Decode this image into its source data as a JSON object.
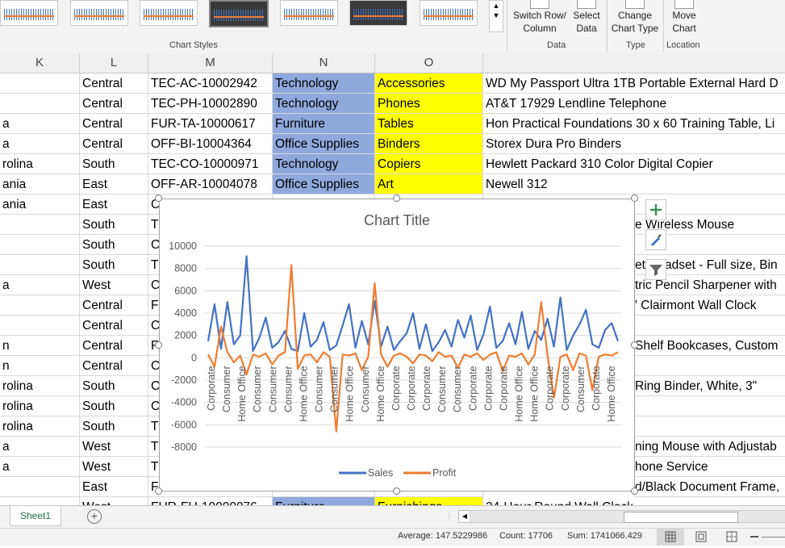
{
  "ribbon": {
    "chart_styles_label": "Chart Styles",
    "switch_row_column": [
      "Switch Row/",
      "Column"
    ],
    "select_data": [
      "Select",
      "Data"
    ],
    "change_chart_type": [
      "Change",
      "Chart Type"
    ],
    "move_chart": [
      "Move",
      "Chart"
    ],
    "group_data": "Data",
    "group_type": "Type",
    "group_location": "Location"
  },
  "columns": [
    "K",
    "L",
    "M",
    "N",
    "O"
  ],
  "rows": [
    [
      "",
      "Central",
      "TEC-AC-10002942",
      "Technology",
      "Accessories",
      "WD My Passport Ultra 1TB Portable External Hard D"
    ],
    [
      "",
      "Central",
      "TEC-PH-10002890",
      "Technology",
      "Phones",
      "AT&T 17929 Lendline Telephone"
    ],
    [
      "a",
      "Central",
      "FUR-TA-10000617",
      "Furniture",
      "Tables",
      "Hon Practical Foundations 30 x 60 Training Table, Li"
    ],
    [
      "a",
      "Central",
      "OFF-BI-10004364",
      "Office Supplies",
      "Binders",
      "Storex Dura Pro Binders"
    ],
    [
      "rolina",
      "South",
      "TEC-CO-10000971",
      "Technology",
      "Copiers",
      "Hewlett Packard 310 Color Digital Copier"
    ],
    [
      "ania",
      "East",
      "OFF-AR-10004078",
      "Office Supplies",
      "Art",
      "Newell 312"
    ],
    [
      "ania",
      "East",
      "C",
      "",
      "",
      ""
    ],
    [
      "",
      "South",
      "T",
      "",
      "",
      "e Wireless Mouse"
    ],
    [
      "",
      "South",
      "C",
      "",
      "",
      ""
    ],
    [
      "",
      "South",
      "T",
      "",
      "",
      "et Headset - Full size, Bin"
    ],
    [
      "a",
      "West",
      "C",
      "",
      "",
      "tric Pencil Sharpener with"
    ],
    [
      "",
      "Central",
      "F",
      "",
      "",
      "' Clairmont Wall Clock"
    ],
    [
      "",
      "Central",
      "C",
      "",
      "",
      ""
    ],
    [
      "n",
      "Central",
      "F",
      "",
      "",
      "Shelf Bookcases, Custom"
    ],
    [
      "n",
      "Central",
      "C",
      "",
      "",
      ""
    ],
    [
      "rolina",
      "South",
      "C",
      "",
      "",
      "Ring Binder, White, 3\""
    ],
    [
      "rolina",
      "South",
      "C",
      "",
      "",
      ""
    ],
    [
      "rolina",
      "South",
      "T",
      "",
      "",
      ""
    ],
    [
      "a",
      "West",
      "T",
      "",
      "",
      "ning Mouse with Adjustab"
    ],
    [
      "a",
      "West",
      "T",
      "",
      "",
      "hone Service"
    ],
    [
      "",
      "East",
      "F",
      "",
      "",
      "d/Black Document Frame,"
    ],
    [
      "",
      "West",
      "FUR-FU-10000076",
      "Furniture",
      "Furnishings",
      "24-Hour Round Wall Clock"
    ]
  ],
  "chart_data": {
    "type": "line",
    "title": "Chart Title",
    "ylim": [
      -8000,
      10000
    ],
    "yticks": [
      10000,
      8000,
      6000,
      4000,
      2000,
      0,
      -2000,
      -4000,
      -6000,
      -8000
    ],
    "xtick_labels": [
      "Corporate",
      "Consumer",
      "Home Office",
      "Consumer",
      "Consumer",
      "Consumer",
      "Home Office",
      "Consumer",
      "Consumer",
      "Home Office",
      "Consumer",
      "Home Office",
      "Corporate",
      "Corporate",
      "Corporate",
      "Consumer",
      "Consumer",
      "Corporate",
      "Corporate",
      "Corporate",
      "Home Office",
      "Home Office",
      "Corporate",
      "Corporate",
      "Consumer",
      "Corporate",
      "Home Office"
    ],
    "grid": true,
    "legend_position": "bottom",
    "series": [
      {
        "name": "Sales",
        "color": "#4472c4",
        "values": [
          1500,
          4800,
          800,
          5000,
          1200,
          2000,
          9100,
          600,
          1800,
          3600,
          900,
          1400,
          2400,
          800,
          600,
          4000,
          1000,
          1600,
          3200,
          700,
          1100,
          2900,
          4800,
          900,
          3300,
          1200,
          5100,
          1000,
          2800,
          700,
          1500,
          2200,
          4000,
          800,
          3000,
          600,
          1400,
          2500,
          1000,
          3400,
          1800,
          3800,
          700,
          2100,
          4600,
          900,
          1500,
          3100,
          1200,
          4100,
          800,
          2400,
          1600,
          3500,
          1000,
          5400,
          700,
          2000,
          3000,
          4300,
          1200,
          900,
          2500,
          3100,
          1500
        ]
      },
      {
        "name": "Profit",
        "color": "#ed7d31",
        "values": [
          300,
          -800,
          2800,
          500,
          -400,
          200,
          -1500,
          300,
          100,
          400,
          -600,
          200,
          500,
          8300,
          -1000,
          200,
          300,
          -400,
          500,
          100,
          -6600,
          300,
          200,
          400,
          -1100,
          100,
          6700,
          300,
          -800,
          200,
          400,
          100,
          -500,
          300,
          200,
          -300,
          500,
          100,
          200,
          -900,
          300,
          100,
          400,
          -200,
          300,
          500,
          -1200,
          200,
          100,
          400,
          -600,
          300,
          5000,
          200,
          -3600,
          100,
          300,
          -1100,
          400,
          200,
          -2900,
          100,
          300,
          200,
          500
        ]
      }
    ]
  },
  "sheet_tab": "Sheet1",
  "status": {
    "average": "Average: 147.5229986",
    "count": "Count: 17706",
    "sum": "Sum: 1741066.429"
  }
}
